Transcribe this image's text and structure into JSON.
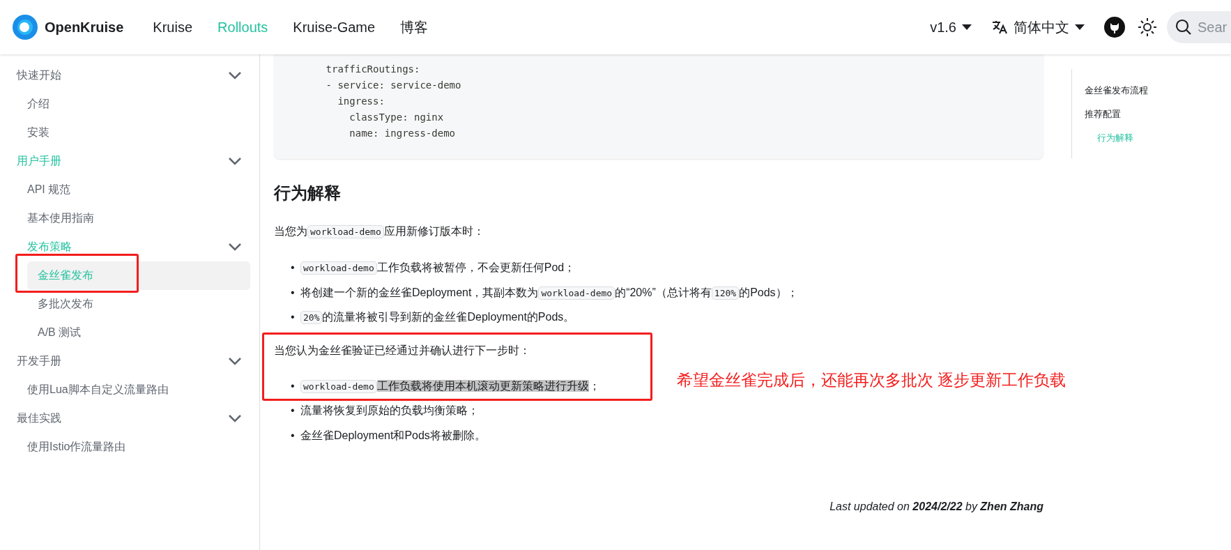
{
  "navbar": {
    "brand": "OpenKruise",
    "links": [
      {
        "label": "Kruise",
        "selected": false
      },
      {
        "label": "Rollouts",
        "selected": true
      },
      {
        "label": "Kruise-Game",
        "selected": false
      },
      {
        "label": "博客",
        "selected": false
      }
    ],
    "version": "v1.6",
    "language": "简体中文",
    "search": {
      "placeholder": "Sear"
    }
  },
  "sidebar": {
    "items": [
      {
        "label": "快速开始",
        "active": false,
        "expanded": true,
        "children": [
          {
            "label": "介绍",
            "selected": false
          },
          {
            "label": "安装",
            "selected": false
          }
        ]
      },
      {
        "label": "用户手册",
        "active": true,
        "expanded": true,
        "children": [
          {
            "label": "API 规范",
            "selected": false
          },
          {
            "label": "基本使用指南",
            "selected": false
          },
          {
            "label": "发布策略",
            "active": true,
            "expanded": true,
            "children": [
              {
                "label": "金丝雀发布",
                "selected": true
              },
              {
                "label": "多批次发布",
                "selected": false
              },
              {
                "label": "A/B 测试",
                "selected": false
              }
            ]
          }
        ]
      },
      {
        "label": "开发手册",
        "active": false,
        "expanded": true,
        "children": [
          {
            "label": "使用Lua脚本自定义流量路由",
            "selected": false
          }
        ]
      },
      {
        "label": "最佳实践",
        "active": false,
        "expanded": true,
        "children": [
          {
            "label": "使用Istio作流量路由",
            "selected": false
          }
        ]
      }
    ]
  },
  "doc": {
    "code_lines": [
      "      trafficRoutings:",
      "      - service: service-demo",
      "        ingress:",
      "          classType: nginx",
      "          name: ingress-demo"
    ],
    "heading": "行为解释",
    "sections": [
      {
        "paragraph": [
          {
            "kind": "text",
            "text": "当您为"
          },
          {
            "kind": "code",
            "text": "workload-demo"
          },
          {
            "kind": "text",
            "text": "应用新修订版本时："
          }
        ],
        "items": [
          {
            "framed": false,
            "bullet": "•",
            "segments": [
              {
                "kind": "code",
                "text": "workload-demo"
              },
              {
                "kind": "text",
                "text": "工作负载将被暂停，不会更新任何Pod；"
              }
            ]
          },
          {
            "framed": false,
            "bullet": "•",
            "segments": [
              {
                "kind": "text",
                "text": "将创建一个新的金丝雀Deployment，其副本数为"
              },
              {
                "kind": "code",
                "text": "workload-demo"
              },
              {
                "kind": "text",
                "text": "的“20%”（总计将有"
              },
              {
                "kind": "code",
                "text": "120%"
              },
              {
                "kind": "text",
                "text": "的Pods）；"
              }
            ]
          },
          {
            "framed": false,
            "bullet": "•",
            "segments": [
              {
                "kind": "code",
                "text": "20%"
              },
              {
                "kind": "text",
                "text": "的流量将被引导到新的金丝雀Deployment的Pods。"
              }
            ]
          }
        ]
      },
      {
        "paragraph": [
          {
            "kind": "text",
            "text": "当您认为金丝雀验证已经通过并确认进行下一步时："
          }
        ],
        "items": [
          {
            "framed": true,
            "bullet": "•",
            "segments": [
              {
                "kind": "code",
                "text": "workload-demo"
              },
              {
                "kind": "selected-text",
                "text": "工作负载将使用本机滚动更新策略进行升级"
              },
              {
                "kind": "text",
                "text": "；"
              }
            ]
          },
          {
            "framed": false,
            "bullet": "•",
            "segments": [
              {
                "kind": "text",
                "text": "流量将恢复到原始的负载均衡策略；"
              }
            ]
          },
          {
            "framed": false,
            "bullet": "•",
            "segments": [
              {
                "kind": "text",
                "text": "金丝雀Deployment和Pods将被删除。"
              }
            ]
          }
        ]
      }
    ],
    "note": "希望金丝雀完成后，还能再次多批次 逐步更新工作负载",
    "last_updated": "Last updated on **2024/2/22** by **Zhen Zhang**"
  },
  "toc": {
    "items": [
      {
        "label": "金丝雀发布流程",
        "selected": false
      },
      {
        "label": "推荐配置",
        "selected": false,
        "children": [
          {
            "label": "行为解释",
            "selected": true
          }
        ]
      }
    ]
  }
}
